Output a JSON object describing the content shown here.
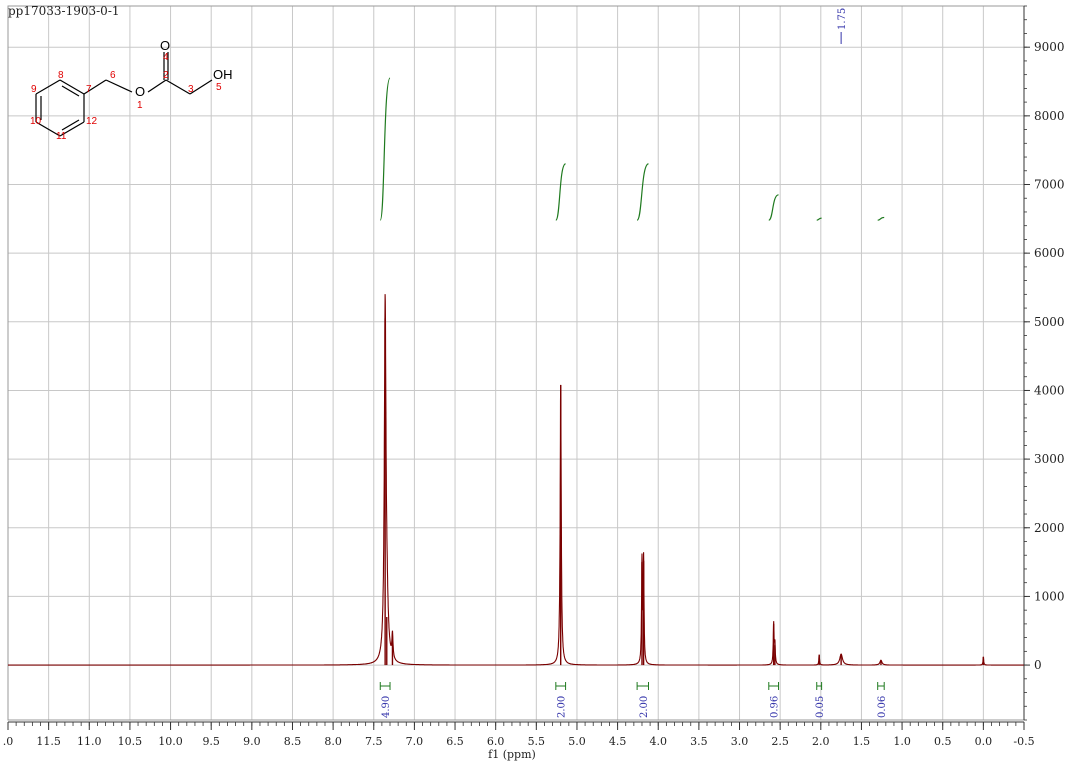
{
  "header": {
    "sample_id": "pp17033-1903-0-1"
  },
  "chart_data": {
    "type": "line",
    "title": "pp17033-1903-0-1",
    "xlabel": "f1 (ppm)",
    "ylabel": "",
    "xlim": [
      12.0,
      -0.5
    ],
    "ylim": [
      -800,
      9600
    ],
    "x_reversed": true,
    "grid": true,
    "x_ticks": [
      ".0",
      "11.5",
      "11.0",
      "10.5",
      "10.0",
      "9.5",
      "9.0",
      "8.5",
      "8.0",
      "7.5",
      "7.0",
      "6.5",
      "6.0",
      "5.5",
      "5.0",
      "4.5",
      "4.0",
      "3.5",
      "3.0",
      "2.5",
      "2.0",
      "1.5",
      "1.0",
      "0.5",
      "0.0",
      "-0.5"
    ],
    "x_tick_values": [
      12.0,
      11.5,
      11.0,
      10.5,
      10.0,
      9.5,
      9.0,
      8.5,
      8.0,
      7.5,
      7.0,
      6.5,
      6.0,
      5.5,
      5.0,
      4.5,
      4.0,
      3.5,
      3.0,
      2.5,
      2.0,
      1.5,
      1.0,
      0.5,
      0.0,
      -0.5
    ],
    "y_ticks": [
      "0",
      "1000",
      "2000",
      "3000",
      "4000",
      "5000",
      "6000",
      "7000",
      "8000",
      "9000"
    ],
    "y_tick_values": [
      0,
      1000,
      2000,
      3000,
      4000,
      5000,
      6000,
      7000,
      8000,
      9000
    ],
    "series": [
      {
        "color": "#7a0000",
        "peaks": [
          {
            "x": 7.36,
            "y": 5050,
            "w": 0.012
          },
          {
            "x": 7.34,
            "y": 700,
            "w": 0.02
          },
          {
            "x": 7.27,
            "y": 360,
            "w": 0.008
          },
          {
            "x": 5.2,
            "y": 4080,
            "w": 0.008
          },
          {
            "x": 4.2,
            "y": 1500,
            "w": 0.006
          },
          {
            "x": 4.18,
            "y": 1520,
            "w": 0.006
          },
          {
            "x": 2.58,
            "y": 600,
            "w": 0.006
          },
          {
            "x": 2.565,
            "y": 290,
            "w": 0.006
          },
          {
            "x": 2.02,
            "y": 150,
            "w": 0.005
          },
          {
            "x": 1.75,
            "y": 160,
            "w": 0.02
          },
          {
            "x": 1.26,
            "y": 70,
            "w": 0.015
          },
          {
            "x": 0.0,
            "y": 120,
            "w": 0.005
          }
        ]
      }
    ],
    "peak_labels": [
      {
        "x": 1.75,
        "label": "1.75"
      }
    ],
    "integrals": [
      {
        "from": 7.42,
        "to": 7.3,
        "value": "4.90",
        "top": 8550
      },
      {
        "from": 5.26,
        "to": 5.14,
        "value": "2.00",
        "top": 7300
      },
      {
        "from": 4.26,
        "to": 4.12,
        "value": "2.00",
        "top": 7300
      },
      {
        "from": 2.64,
        "to": 2.52,
        "value": "0.96",
        "top": 6850
      },
      {
        "from": 2.05,
        "to": 1.99,
        "value": "0.05",
        "top": 6510
      },
      {
        "from": 1.3,
        "to": 1.22,
        "value": "0.06",
        "top": 6520
      }
    ],
    "integral_color": "#1f7a1f"
  },
  "structure": {
    "atoms": {
      "O_carbonyl": "O",
      "O_ester": "O",
      "OH": "OH"
    },
    "numbers": [
      "1",
      "2",
      "3",
      "4",
      "5",
      "6",
      "7",
      "8",
      "9",
      "10",
      "11",
      "12"
    ]
  }
}
